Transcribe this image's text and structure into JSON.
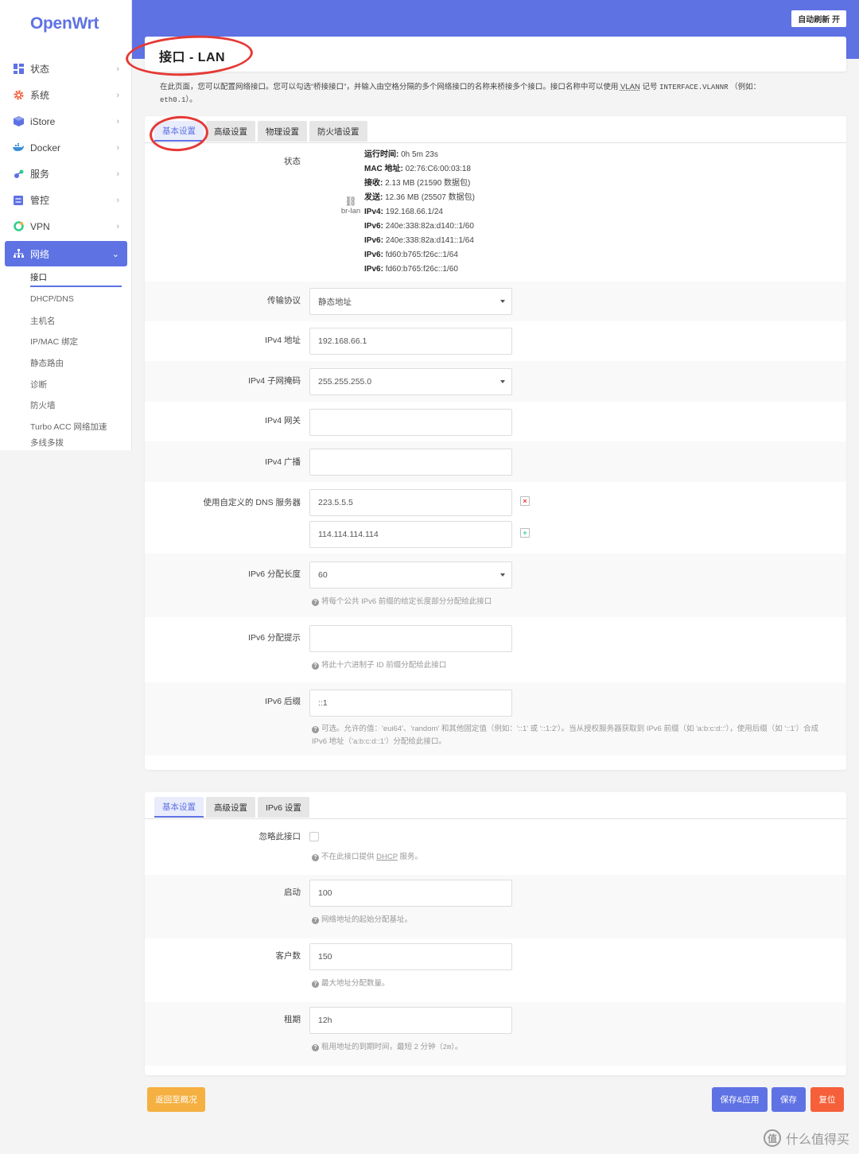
{
  "logo": "OpenWrt",
  "autorefresh": "自动刷新 开",
  "title": "接口 - LAN",
  "description_part1": "在此页面，您可以配置网络接口。您可以勾选“桥接接口”，并输入由空格分隔的多个网络接口的名称来桥接多个接口。接口名称中可以使用",
  "description_vlan": "VLAN",
  "description_part2": "记号",
  "description_code": "INTERFACE.VLANNR",
  "description_part3": "（例如：",
  "description_example": "eth0.1",
  "description_end": "）。",
  "nav": {
    "items": [
      {
        "label": "状态",
        "icon": "dashboard-icon"
      },
      {
        "label": "系统",
        "icon": "gear-icon"
      },
      {
        "label": "iStore",
        "icon": "box-icon"
      },
      {
        "label": "Docker",
        "icon": "docker-icon"
      },
      {
        "label": "服务",
        "icon": "services-icon"
      },
      {
        "label": "管控",
        "icon": "control-icon"
      },
      {
        "label": "VPN",
        "icon": "vpn-icon"
      }
    ],
    "active": {
      "label": "网络",
      "icon": "network-icon"
    },
    "sub": [
      "接口",
      "DHCP/DNS",
      "主机名",
      "IP/MAC 绑定",
      "静态路由",
      "诊断",
      "防火墙",
      "Turbo ACC 网络加速",
      "多线多拨"
    ]
  },
  "tabs1": [
    "基本设置",
    "高级设置",
    "物理设置",
    "防火墙设置"
  ],
  "tabs2": [
    "基本设置",
    "高级设置",
    "IPv6 设置"
  ],
  "status": {
    "label": "状态",
    "device": "br-lan",
    "uptime_k": "运行时间:",
    "uptime_v": "0h 5m 23s",
    "mac_k": "MAC 地址:",
    "mac_v": "02:76:C6:00:03:18",
    "rx_k": "接收:",
    "rx_v": "2.13 MB (21590 数据包)",
    "tx_k": "发送:",
    "tx_v": "12.36 MB (25507 数据包)",
    "ipv4_k": "IPv4:",
    "ipv4_v": "192.168.66.1/24",
    "ipv6_k": "IPv6:",
    "ipv6_1": "240e:338:82a:d140::1/60",
    "ipv6_2": "240e:338:82a:d141::1/64",
    "ipv6_3": "fd60:b765:f26c::1/64",
    "ipv6_4": "fd60:b765:f26c::1/60"
  },
  "form": {
    "proto_label": "传输协议",
    "proto_value": "静态地址",
    "ipv4addr_label": "IPv4 地址",
    "ipv4addr_value": "192.168.66.1",
    "netmask_label": "IPv4 子网掩码",
    "netmask_value": "255.255.255.0",
    "gateway_label": "IPv4 网关",
    "gateway_value": "",
    "broadcast_label": "IPv4 广播",
    "broadcast_value": "",
    "dns_label": "使用自定义的 DNS 服务器",
    "dns1": "223.5.5.5",
    "dns2": "114.114.114.114",
    "ip6len_label": "IPv6 分配长度",
    "ip6len_value": "60",
    "ip6len_hint": "将每个公共 IPv6 前缀的给定长度部分分配给此接口",
    "ip6hint_label": "IPv6 分配提示",
    "ip6hint_value": "",
    "ip6hint_hint": "将此十六进制子 ID 前缀分配给此接口",
    "ip6suffix_label": "IPv6 后缀",
    "ip6suffix_value": "::1",
    "ip6suffix_hint": "可选。允许的值：'eui64'、'random' 和其他固定值（例如：'::1' 或 '::1:2'）。当从授权服务器获取到 IPv6 前缀（如 'a:b:c:d::'），使用后缀（如 '::1'）合成 IPv6 地址（'a:b:c:d::1'）分配给此接口。"
  },
  "dhcp": {
    "ignore_label": "忽略此接口",
    "ignore_hint_pre": "不在此接口提供",
    "ignore_hint_dhcp": "DHCP",
    "ignore_hint_post": "服务。",
    "start_label": "启动",
    "start_value": "100",
    "start_hint": "网络地址的起始分配基址。",
    "limit_label": "客户数",
    "limit_value": "150",
    "limit_hint": "最大地址分配数量。",
    "lease_label": "租期",
    "lease_value": "12h",
    "lease_hint_pre": "租用地址的到期时间，最短 2 分钟",
    "lease_hint_code": "（2m）",
    "lease_hint_post": "。"
  },
  "buttons": {
    "back": "返回至概况",
    "save_apply": "保存&应用",
    "save": "保存",
    "reset": "复位"
  },
  "watermark": "什么值得买",
  "colors": {
    "accent": "#5e72e4",
    "warning": "#f5b041",
    "danger": "#f5603a",
    "annotation": "#e53935"
  }
}
